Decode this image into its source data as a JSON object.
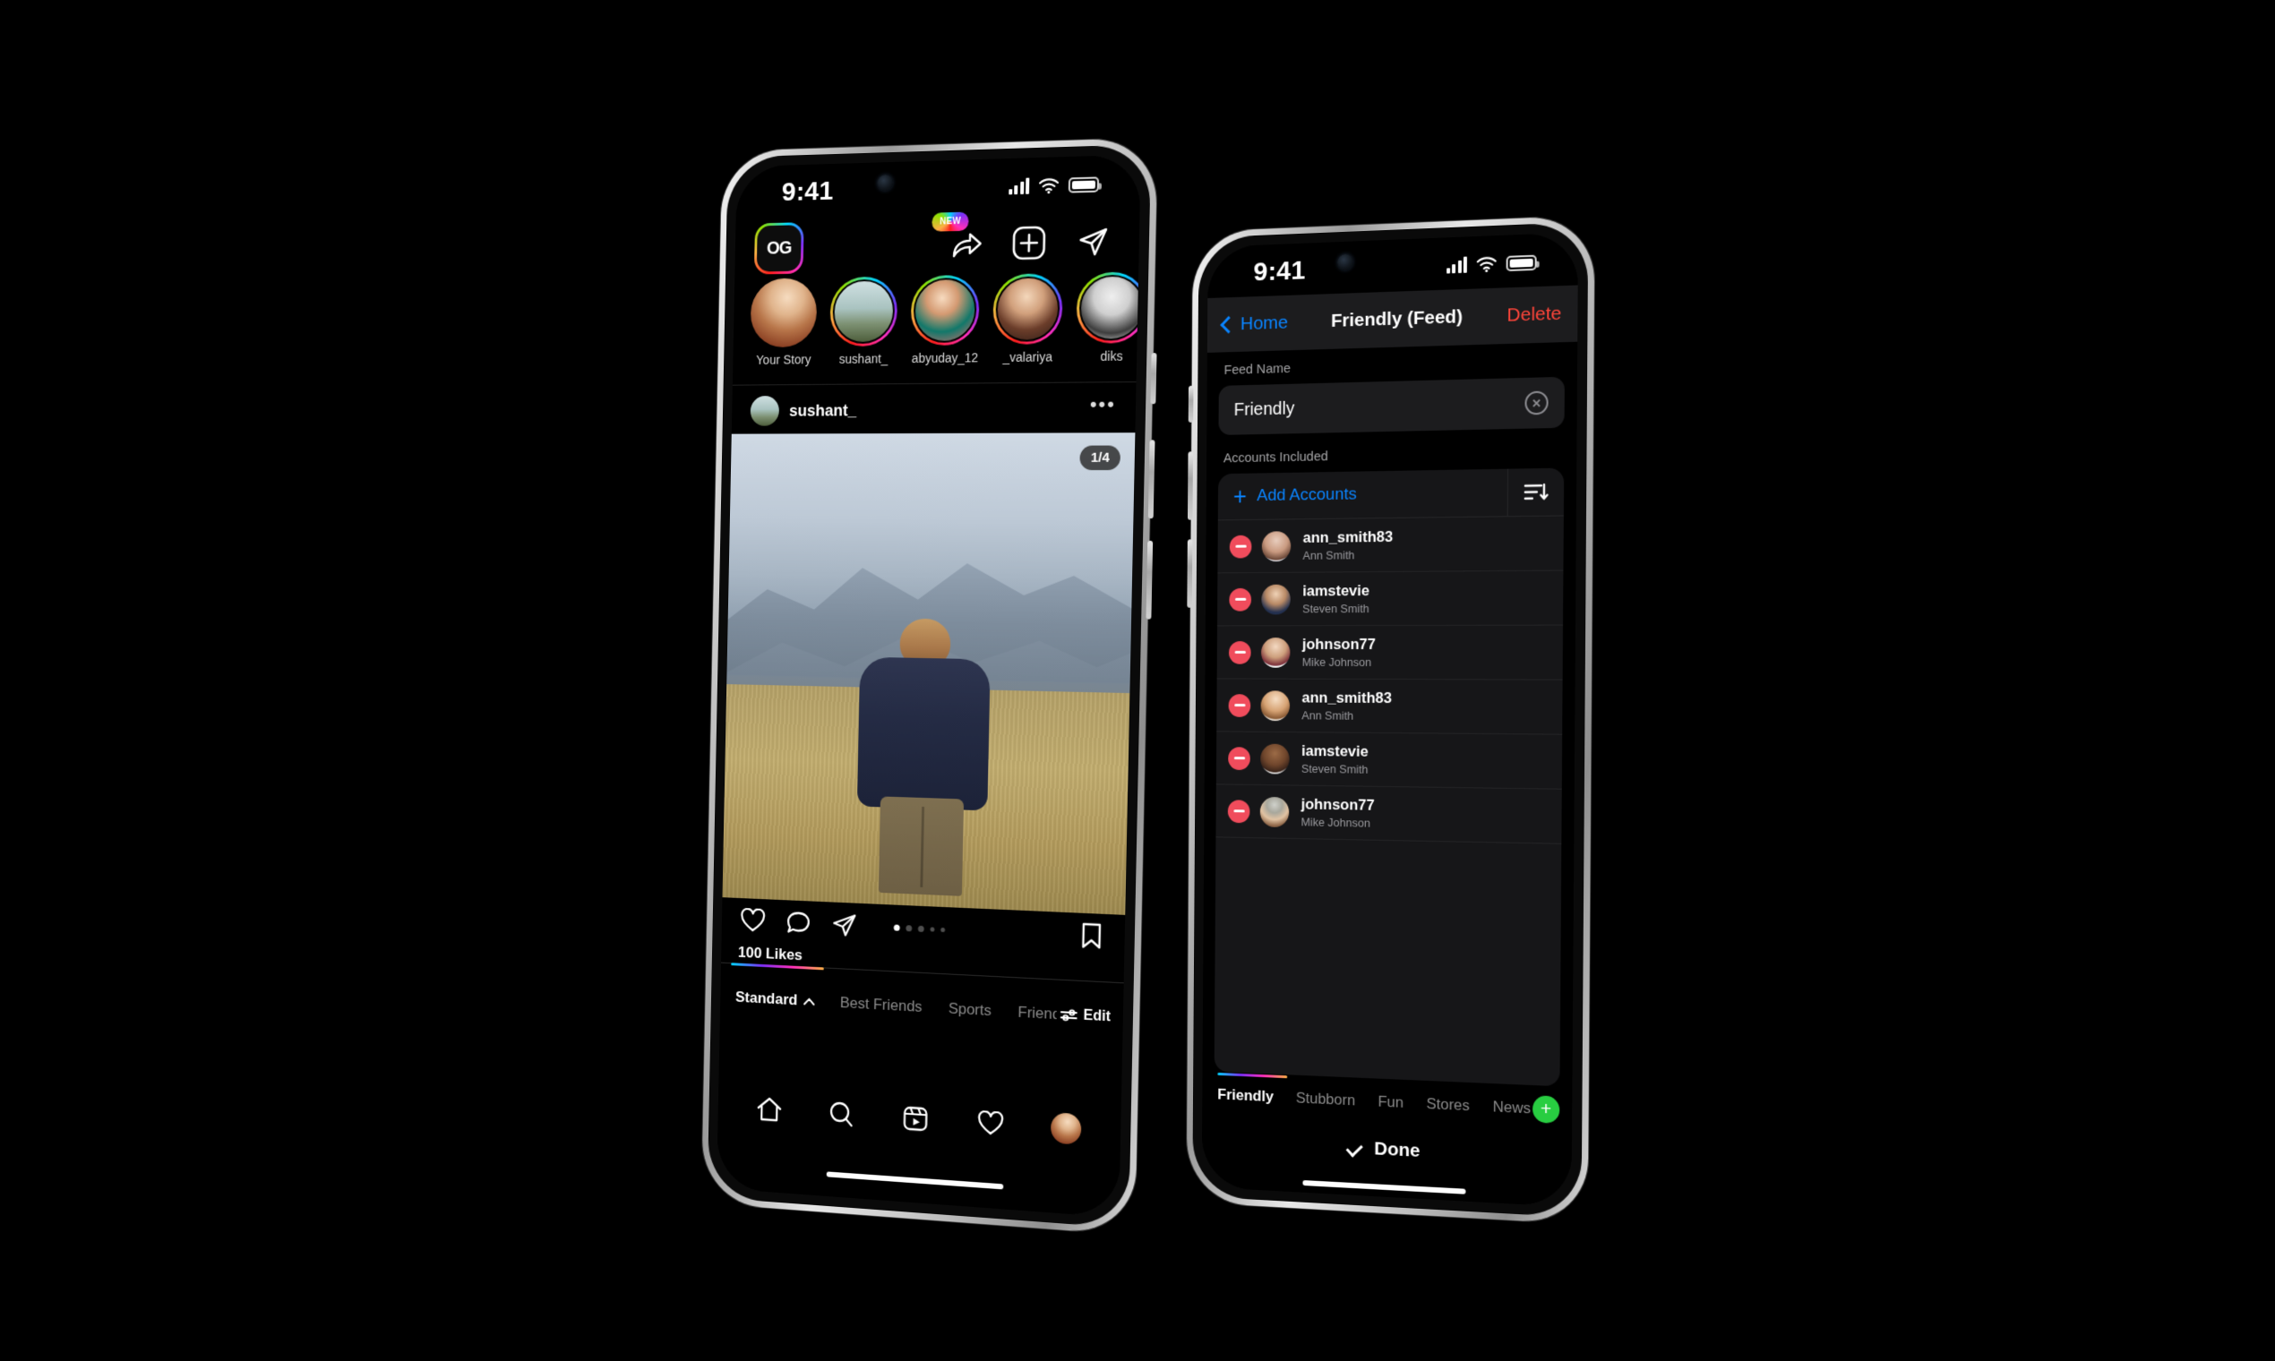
{
  "scene": {
    "background_color": "#000000",
    "description": "Two iPhone mockups on black background showing a social feed app"
  },
  "left_phone": {
    "status_bar": {
      "time": "9:41",
      "signal": "signal-bars",
      "wifi": "wifi",
      "battery": "battery-full"
    },
    "top_bar": {
      "logo_text": "OG",
      "icons": [
        {
          "name": "share-arrow-icon",
          "badge": "NEW"
        },
        {
          "name": "add-post-icon",
          "badge": ""
        },
        {
          "name": "direct-message-icon",
          "badge": ""
        }
      ]
    },
    "stories": [
      {
        "name": "Your Story",
        "has_ring": false
      },
      {
        "name": "sushant_",
        "has_ring": true
      },
      {
        "name": "abyuday_12",
        "has_ring": true
      },
      {
        "name": "_valariya",
        "has_ring": true
      },
      {
        "name": "diks",
        "has_ring": true
      }
    ],
    "post": {
      "username": "sushant_",
      "more_label": "•••",
      "page_counter": "1/4",
      "likes": "100 Likes",
      "carousel_dots": 5,
      "carousel_active_index": 0,
      "actions": [
        "like-icon",
        "comment-icon",
        "share-icon",
        "save-icon"
      ]
    },
    "filters": {
      "items": [
        "Standard",
        "Best Friends",
        "Sports",
        "Friends"
      ],
      "active": "Standard",
      "edit_label": "Edit"
    },
    "tab_bar": [
      "home-icon",
      "search-icon",
      "reels-icon",
      "activity-icon",
      "profile-avatar"
    ]
  },
  "right_phone": {
    "status_bar": {
      "time": "9:41",
      "signal": "signal-bars",
      "wifi": "wifi",
      "battery": "battery-full"
    },
    "nav": {
      "back_label": "Home",
      "title": "Friendly (Feed)",
      "delete_label": "Delete"
    },
    "feed_name": {
      "label": "Feed Name",
      "value": "Friendly",
      "clear_icon": "clear-circle-icon"
    },
    "accounts": {
      "label": "Accounts Included",
      "add_label": "Add Accounts",
      "sort_icon": "sort-descending-icon",
      "rows": [
        {
          "username": "ann_smith83",
          "name": "Ann Smith"
        },
        {
          "username": "iamstevie",
          "name": "Steven Smith"
        },
        {
          "username": "johnson77",
          "name": "Mike Johnson"
        },
        {
          "username": "ann_smith83",
          "name": "Ann Smith"
        },
        {
          "username": "iamstevie",
          "name": "Steven Smith"
        },
        {
          "username": "johnson77",
          "name": "Mike Johnson"
        }
      ]
    },
    "feed_tabs": {
      "items": [
        "Friendly",
        "Stubborn",
        "Fun",
        "Stores",
        "News"
      ],
      "active": "Friendly",
      "add_label": "+"
    },
    "done_button": {
      "label": "Done",
      "icon": "check-icon"
    }
  },
  "colors": {
    "accent_blue": "#0a84ff",
    "destructive_red": "#ff453a",
    "remove_red": "#f04c5c",
    "add_green": "#28cd41",
    "surface": "#1c1c1e",
    "card": "#161618",
    "muted_text": "#8b8b8b"
  }
}
